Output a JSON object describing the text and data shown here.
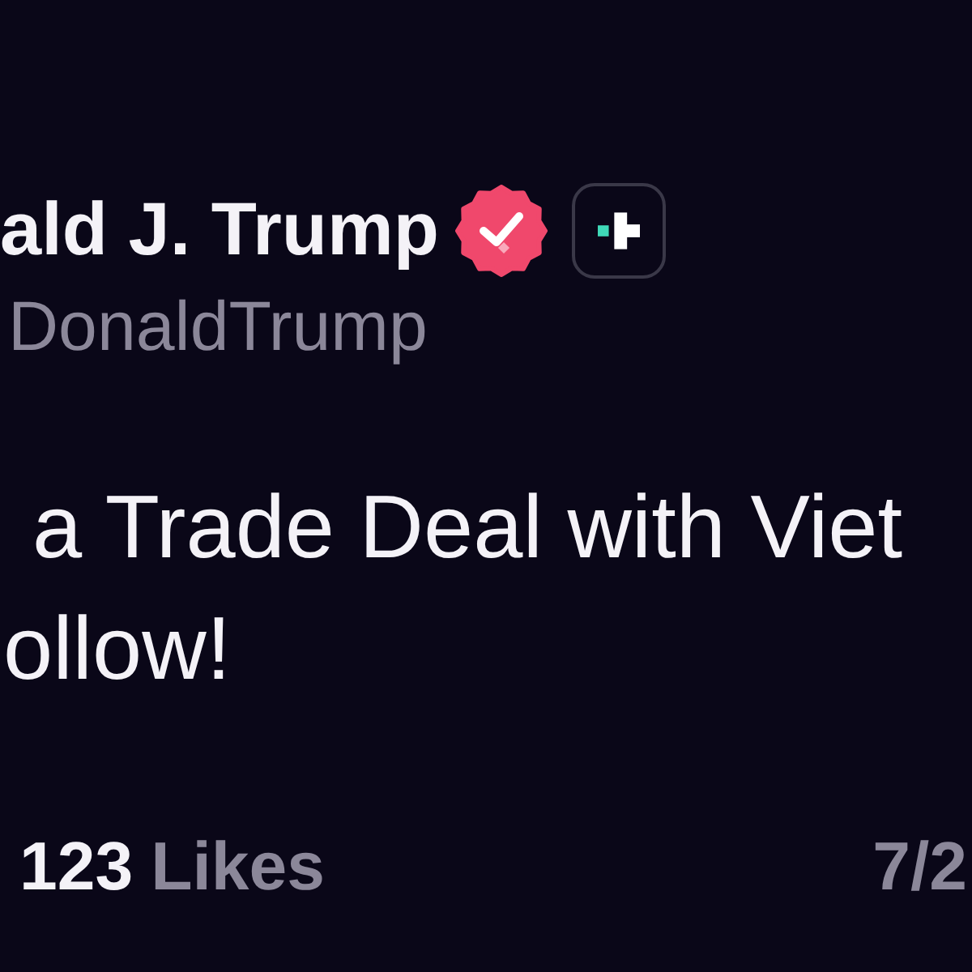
{
  "post": {
    "author_name": "ald J. Trump",
    "verified": true,
    "handle": "DonaldTrump",
    "body_lines": [
      "a Trade Deal with Viet",
      "ollow!"
    ],
    "likes_count": "123",
    "likes_label": "Likes",
    "date": "7/2"
  }
}
